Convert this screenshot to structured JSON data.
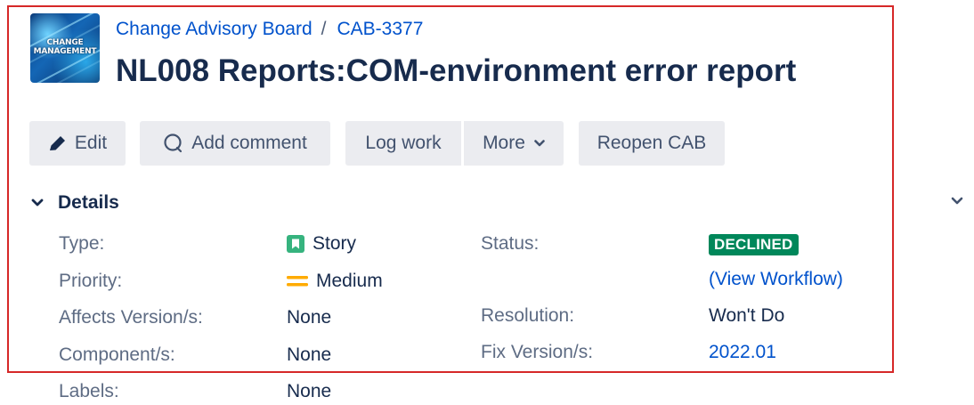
{
  "header": {
    "project_link": "Change Advisory Board",
    "separator": "/",
    "issue_key": "CAB-3377",
    "title": "NL008 Reports:COM-environment error report",
    "logo_text_line1": "CHANGE",
    "logo_text_line2": "MANAGEMENT"
  },
  "toolbar": {
    "edit_label": "Edit",
    "add_comment_label": "Add comment",
    "log_work_label": "Log work",
    "more_label": "More",
    "reopen_label": "Reopen CAB"
  },
  "details": {
    "section_label": "Details",
    "type_label": "Type:",
    "type_value": "Story",
    "priority_label": "Priority:",
    "priority_value": "Medium",
    "affects_label": "Affects Version/s:",
    "affects_value": "None",
    "component_label": "Component/s:",
    "component_value": "None",
    "labels_label": "Labels:",
    "labels_value": "None",
    "status_label": "Status:",
    "status_value": "DECLINED",
    "workflow_link": "(View Workflow)",
    "resolution_label": "Resolution:",
    "resolution_value": "Won't Do",
    "fix_label": "Fix Version/s:",
    "fix_value": "2022.01"
  },
  "colors": {
    "link": "#0052cc",
    "status_declined": "#00875a",
    "story_icon": "#36b37e",
    "priority_medium": "#ffab00",
    "highlight_border": "#d62828"
  },
  "icons": {
    "edit": "pencil-icon",
    "comment": "comment-icon",
    "more": "chevron-down-icon",
    "details_toggle": "chevron-down-icon",
    "type": "story-icon",
    "priority": "priority-medium-icon"
  }
}
